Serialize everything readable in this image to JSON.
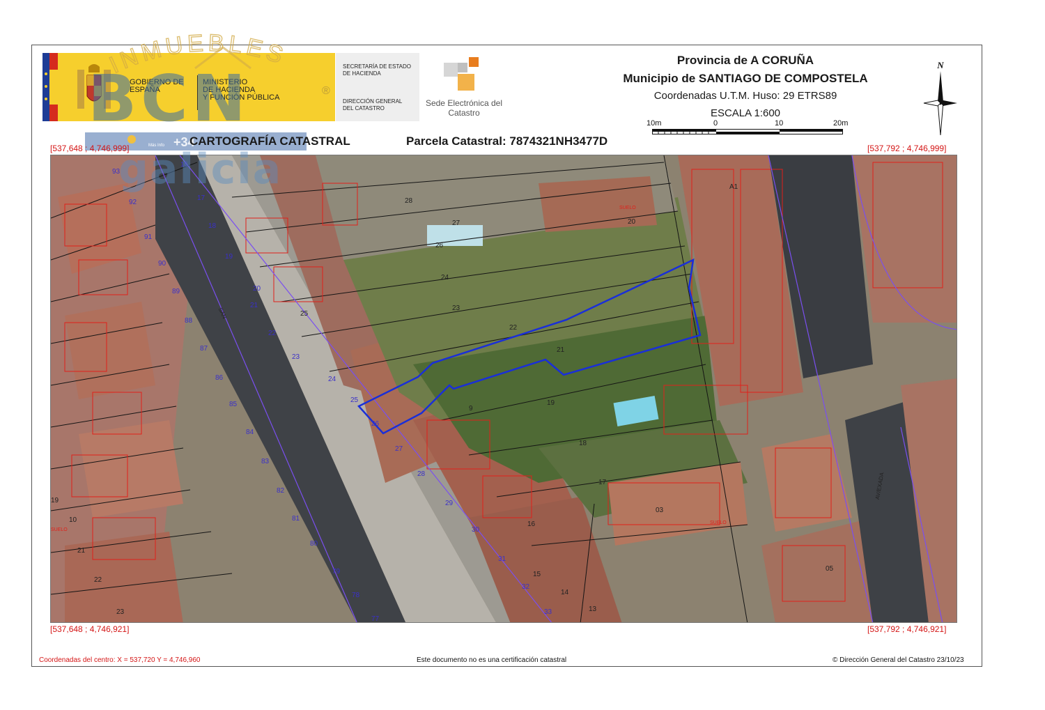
{
  "header": {
    "gobierno": "GOBIERNO DE ESPAÑA",
    "ministerio": [
      "MINISTERIO",
      "DE HACIENDA",
      "Y FUNCIÓN PÚBLICA"
    ],
    "secretaria": [
      "SECRETARÍA DE ESTADO",
      "DE HACIENDA"
    ],
    "direccion": [
      "DIRECCIÓN GENERAL",
      "DEL CATASTRO"
    ],
    "sede": "Sede Electrónica del Catastro",
    "provincia": "Provincia de A CORUÑA",
    "municipio": "Municipio de SANTIAGO DE COMPOSTELA",
    "coordenadas": "Coordenadas U.T.M. Huso: 29 ETRS89",
    "escala": "ESCALA 1:600",
    "scale_labels": [
      "10m",
      "0",
      "10",
      "20m"
    ],
    "north": "N"
  },
  "title": {
    "main": "CARTOGRAFÍA CATASTRAL",
    "parcela": "Parcela Catastral: 7874321NH3477D"
  },
  "watermark": {
    "brand_top": "INMUEBLES",
    "brand_mid": "BCN",
    "brand_reg": "®",
    "phone": "+34",
    "small": "Más Info",
    "bottom": "galicia"
  },
  "corners": {
    "top_left": "[537,648 ; 4,746,999]",
    "top_right": "[537,792 ; 4,746,999]",
    "bottom_left": "[537,648 ; 4,746,921]",
    "bottom_right": "[537,792 ; 4,746,921]"
  },
  "map": {
    "street_numbers_left": [
      "93",
      "92",
      "91",
      "90",
      "89",
      "88",
      "87",
      "86",
      "85",
      "84",
      "83",
      "82",
      "81",
      "80",
      "79",
      "78",
      "77"
    ],
    "street_numbers_right": [
      "16",
      "17",
      "18",
      "19",
      "20",
      "21",
      "22",
      "23",
      "24",
      "25",
      "26",
      "27",
      "28",
      "29",
      "30",
      "31",
      "32",
      "33"
    ],
    "parcel_labels": [
      "28",
      "27",
      "26",
      "25",
      "24",
      "23",
      "22",
      "21",
      "20",
      "19",
      "18",
      "17",
      "16",
      "15",
      "14",
      "13",
      "03",
      "05",
      "A1",
      "9",
      "19",
      "21",
      "22",
      "23",
      "10"
    ],
    "suelo": [
      "SUELO",
      "SUELO",
      "SUELO"
    ],
    "street_text": [
      "SAN",
      "AV/EXADA"
    ]
  },
  "colors": {
    "parcel_outline": "#1a2fd8",
    "cadastral_red": "#e0201a",
    "street_axis": "#7a4ff0",
    "gov_yellow": "#f6cf2d"
  },
  "footer": {
    "left": "Coordenadas del centro: X = 537,720 Y = 4,746,960",
    "center": "Este documento no es una certificación catastral",
    "right": "© Dirección General del Catastro 23/10/23"
  }
}
